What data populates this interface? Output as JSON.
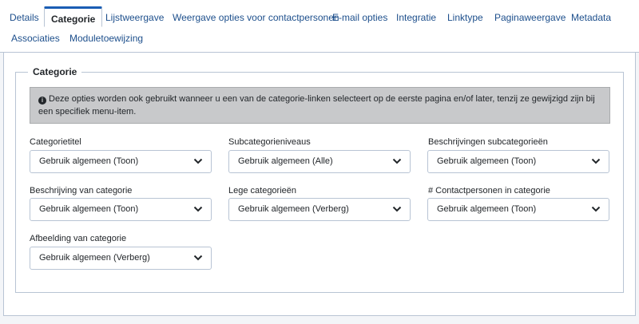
{
  "tabs": [
    {
      "label": "Details"
    },
    {
      "label": "Categorie"
    },
    {
      "label": "Lijstweergave"
    },
    {
      "label": "Weergave opties voor contactpersonen"
    },
    {
      "label": "E-mail opties"
    },
    {
      "label": "Integratie"
    },
    {
      "label": "Linktype"
    },
    {
      "label": "Paginaweergave"
    },
    {
      "label": "Metadata"
    },
    {
      "label": "Associaties"
    },
    {
      "label": "Moduletoewijzing"
    }
  ],
  "active_tab": "Categorie",
  "fieldset": {
    "legend": "Categorie",
    "alert": "Deze opties worden ook gebruikt wanneer u een van de categorie-linken selecteert op de eerste pagina en/of later, tenzij ze gewijzigd zijn bij een specifiek menu-item."
  },
  "fields": [
    {
      "label": "Categorietitel",
      "value": "Gebruik algemeen (Toon)"
    },
    {
      "label": "Subcategorieniveaus",
      "value": "Gebruik algemeen (Alle)"
    },
    {
      "label": "Beschrijvingen subcategorieën",
      "value": "Gebruik algemeen (Toon)"
    },
    {
      "label": "Beschrijving van categorie",
      "value": "Gebruik algemeen (Toon)"
    },
    {
      "label": "Lege categorieën",
      "value": "Gebruik algemeen (Verberg)"
    },
    {
      "label": "# Contactpersonen in categorie",
      "value": "Gebruik algemeen (Toon)"
    },
    {
      "label": "Afbeelding van categorie",
      "value": "Gebruik algemeen (Verberg)"
    }
  ],
  "colors": {
    "link": "#1d4f8c",
    "active_tab_accent": "#1a5db4",
    "alert_bg": "#c8c9cb",
    "border": "#b8c4d4"
  }
}
